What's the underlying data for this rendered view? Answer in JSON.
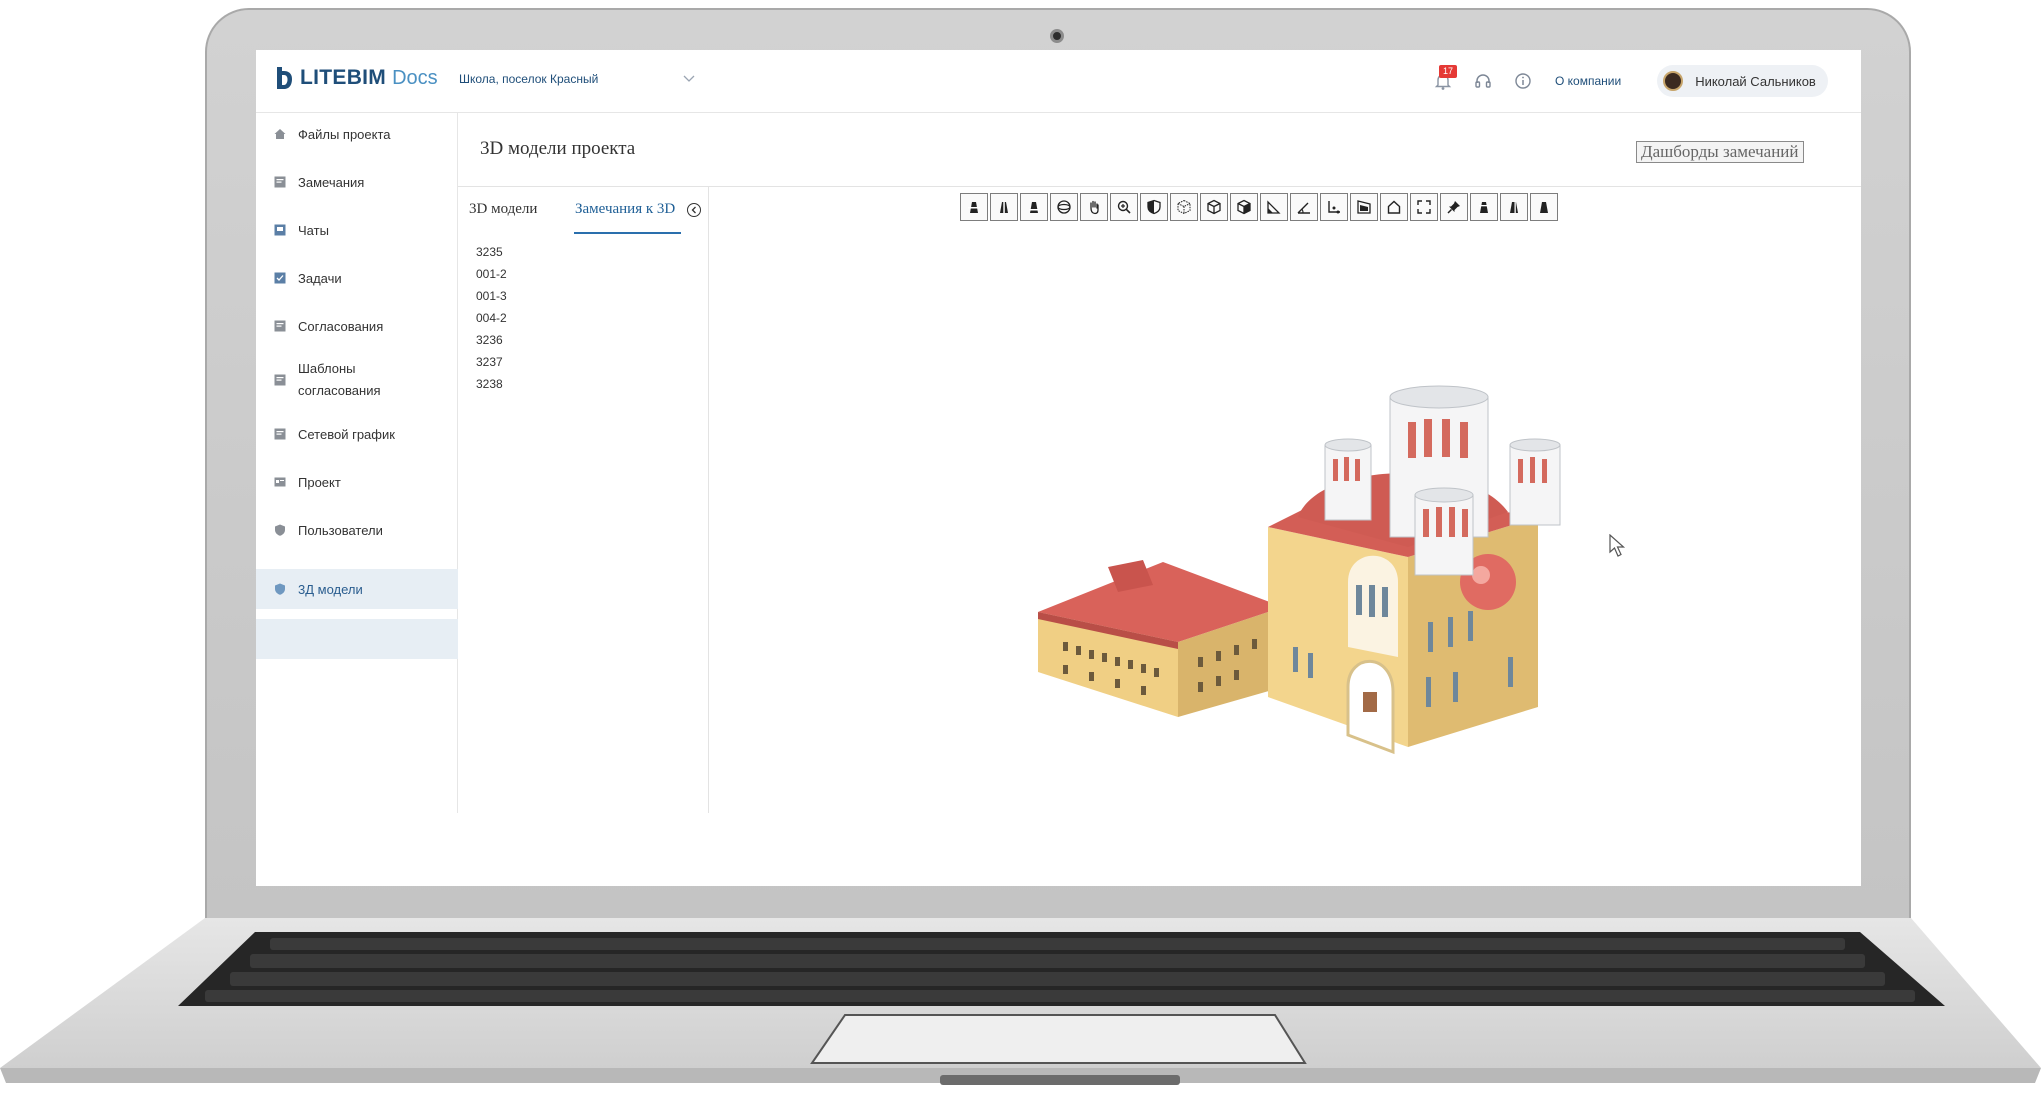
{
  "header": {
    "logo_text": "LITEBIM",
    "logo_suffix": "Docs",
    "project": "Школа, поселок Красный",
    "notifications_count": "17",
    "about_label": "О компании",
    "user_name": "Николай Сальников"
  },
  "sidebar": {
    "items": [
      {
        "label": "Файлы проекта",
        "icon": "home-icon"
      },
      {
        "label": "Замечания",
        "icon": "document-icon"
      },
      {
        "label": "Чаты",
        "icon": "chat-icon"
      },
      {
        "label": "Задачи",
        "icon": "task-icon"
      },
      {
        "label": "Согласования",
        "icon": "document-icon"
      },
      {
        "label": "Шаблоны согласования",
        "icon": "document-icon"
      },
      {
        "label": "Сетевой график",
        "icon": "document-icon"
      },
      {
        "label": "Проект",
        "icon": "id-card-icon"
      },
      {
        "label": "Пользователи",
        "icon": "shield-icon"
      },
      {
        "label": "3Д модели",
        "icon": "shield-icon",
        "active": true
      }
    ]
  },
  "main": {
    "title": "3D модели проекта",
    "dashboard_button": "Дашборды замечаний",
    "tabs": [
      {
        "label": "3D модели"
      },
      {
        "label": "Замечания к 3D",
        "active": true
      }
    ],
    "models": [
      "3235",
      "001-2",
      "001-3",
      "004-2",
      "3236",
      "3237",
      "3238"
    ]
  },
  "viewer": {
    "tools": [
      "section-box-icon",
      "section-x-icon",
      "section-y-icon",
      "orbit-icon",
      "pan-icon",
      "zoom-icon",
      "shade-icon",
      "wireframe-icon",
      "cube-icon",
      "cube-solid-icon",
      "ruler-icon",
      "angle-icon",
      "measure-icon",
      "area-icon",
      "home-view-icon",
      "fullscreen-icon",
      "pin-icon",
      "clip-a-icon",
      "clip-b-icon",
      "clip-c-icon"
    ]
  },
  "colors": {
    "accent": "#2a6fad",
    "brand": "#1f4e79",
    "active_bg": "#e7eef4",
    "badge": "#e53935"
  }
}
